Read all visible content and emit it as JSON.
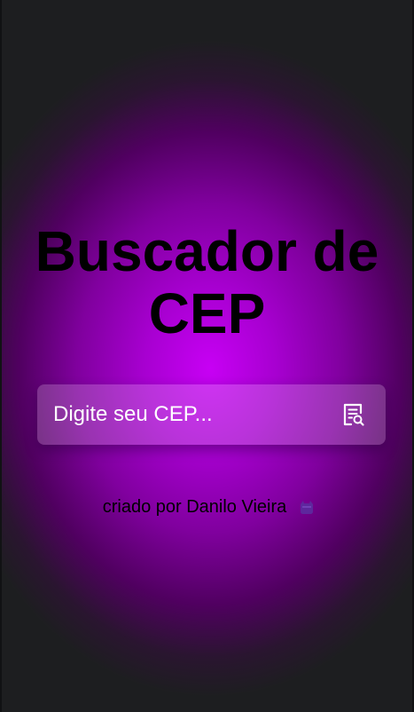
{
  "header": {
    "title": "Buscador de CEP"
  },
  "search": {
    "placeholder": "Digite seu CEP...",
    "value": "",
    "button_icon": "document-search-icon"
  },
  "footer": {
    "credit_text": "criado por Danilo Vieira",
    "link_icon": "github-icon"
  },
  "colors": {
    "background_center": "#c700f4",
    "background_edge": "#1d1e20",
    "title": "#000000",
    "input_text": "#ffffff",
    "link_icon": "#5a2ea0"
  }
}
